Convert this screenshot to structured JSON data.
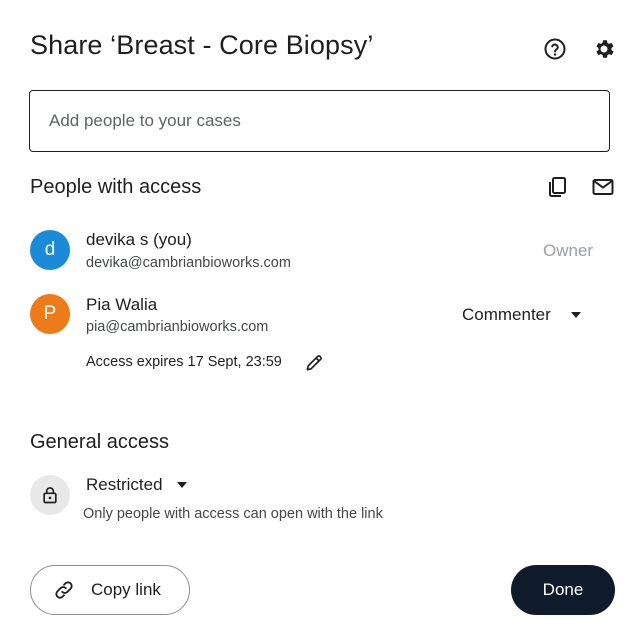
{
  "dialog": {
    "title": "Share ‘Breast - Core Biopsy’",
    "help_icon": "help-circle-icon",
    "settings_icon": "gear-icon"
  },
  "add_people": {
    "placeholder": "Add people to your cases",
    "value": ""
  },
  "people_with_access": {
    "title": "People with access",
    "copy_icon": "copy-icon",
    "mail_icon": "mail-icon",
    "people": [
      {
        "initial": "d",
        "name": "devika s (you)",
        "email": "devika@cambrianbioworks.com",
        "role": "Owner",
        "avatar_color": "#1a8bd8"
      },
      {
        "initial": "P",
        "name": "Pia Walia",
        "email": "pia@cambrianbioworks.com",
        "role": "Commenter",
        "avatar_color": "#ee7a18",
        "expires": "Access expires 17 Sept, 23:59"
      }
    ]
  },
  "general_access": {
    "title": "General access",
    "lock_icon": "lock-icon",
    "setting": "Restricted",
    "description": "Only people with access can open with the link"
  },
  "footer": {
    "copy_link_label": "Copy link",
    "link_icon": "link-icon",
    "done_label": "Done"
  },
  "colors": {
    "primary_dark": "#0f1b2a",
    "owner_text": "#9aa0a6",
    "secondary_text": "#444746"
  }
}
